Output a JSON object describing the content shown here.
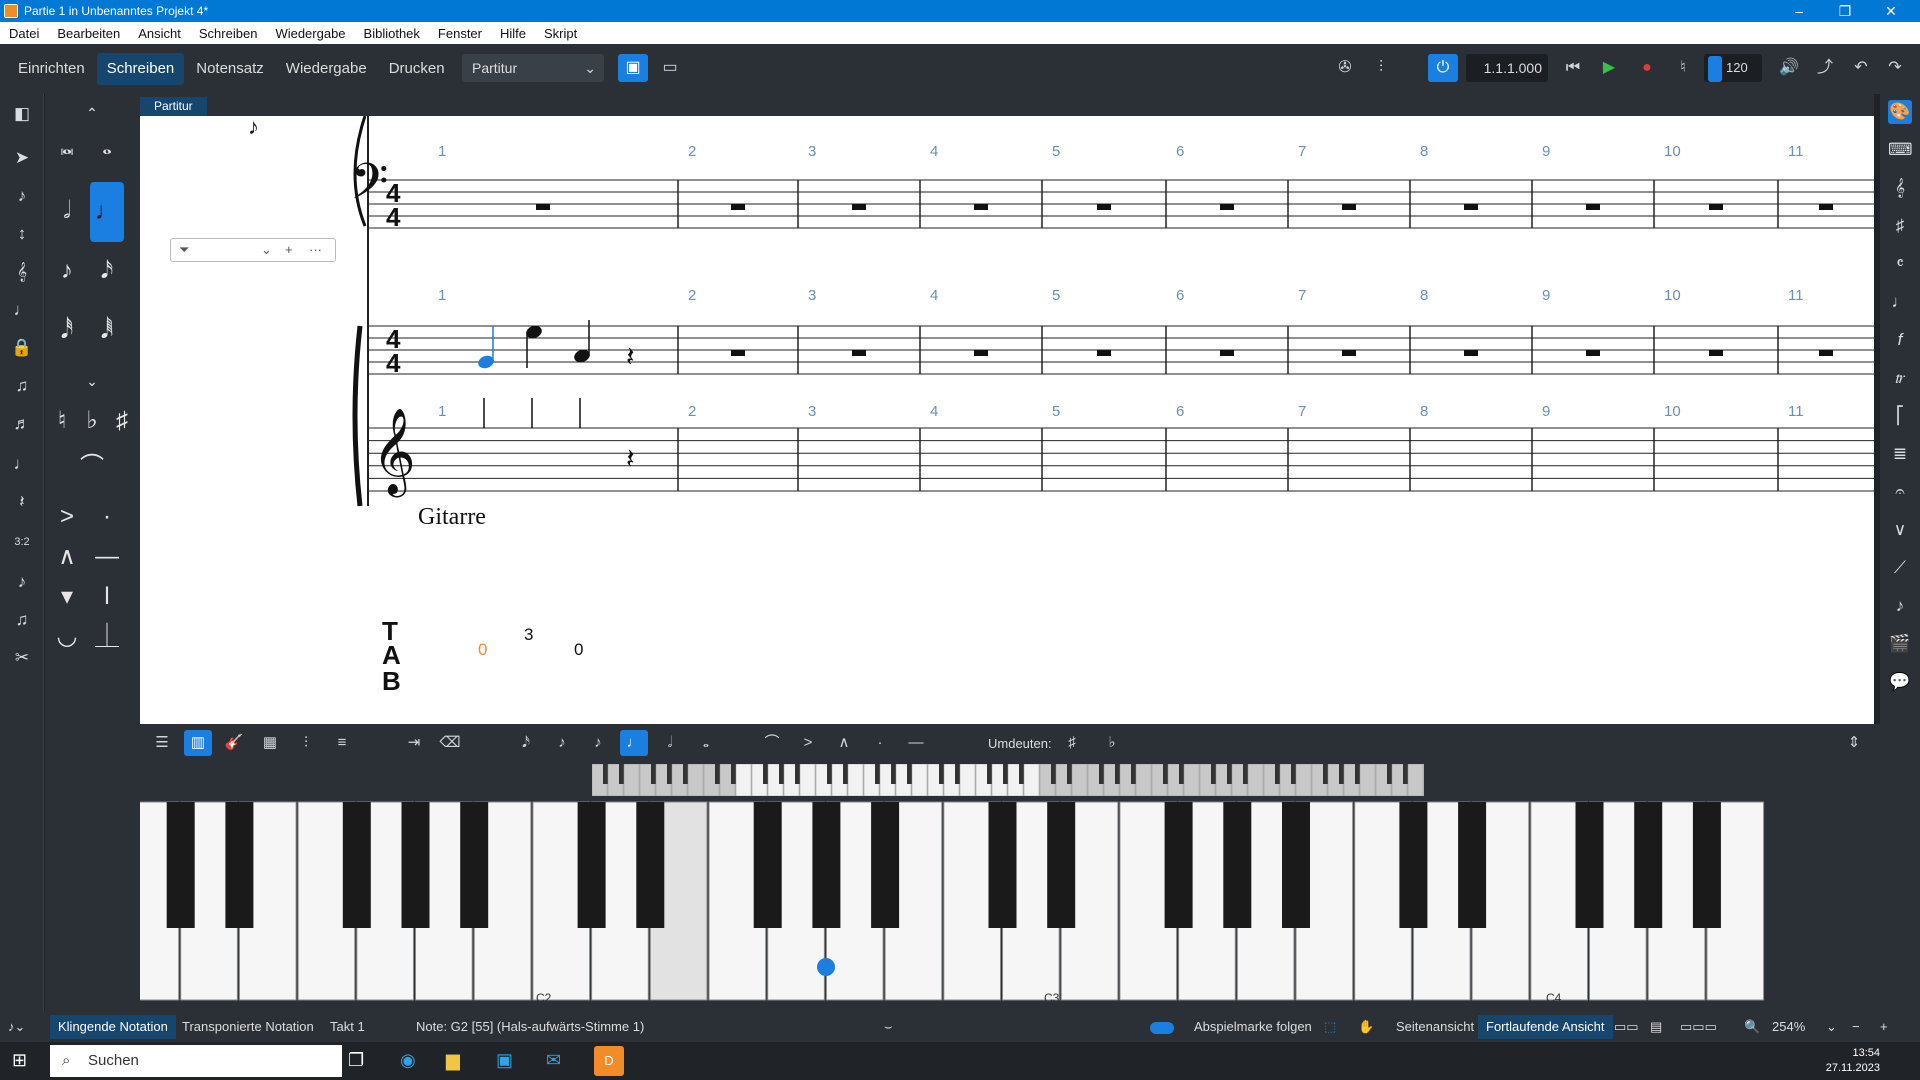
{
  "window": {
    "title": "Partie 1 in Unbenanntes Projekt 4*"
  },
  "menu": [
    "Datei",
    "Bearbeiten",
    "Ansicht",
    "Schreiben",
    "Wiedergabe",
    "Bibliothek",
    "Fenster",
    "Hilfe",
    "Skript"
  ],
  "modes": [
    "Einrichten",
    "Schreiben",
    "Notensatz",
    "Wiedergabe",
    "Drucken"
  ],
  "active_mode": "Schreiben",
  "layout_select": "Partitur",
  "transport": {
    "position": "1.1.1.000",
    "tempo": "120"
  },
  "score_tab": "Partitur",
  "score": {
    "instrument": "Gitarre",
    "bars_top": [
      "1",
      "2",
      "3",
      "4",
      "5",
      "6",
      "7",
      "8",
      "9",
      "10",
      "11"
    ],
    "time_sig": "4/4",
    "tab_letters": [
      "T",
      "A",
      "B"
    ],
    "tab_numbers": [
      "0",
      "3",
      "0"
    ]
  },
  "lower_zone": {
    "label": "Umdeuten:"
  },
  "keyboard": {
    "labels": [
      "C2",
      "C3",
      "C4"
    ]
  },
  "status": {
    "left_sel": "Klingende Notation",
    "transposed": "Transponierte Notation",
    "bar": "Takt 1",
    "note": "Note: G2 [55] (Hals-aufwärts-Stimme 1)",
    "follow": "Abspielmarke folgen",
    "page_view": "Seitenansicht",
    "galley_view": "Fortlaufende Ansicht",
    "zoom": "254%"
  },
  "taskbar": {
    "search": "Suchen",
    "time": "13:54",
    "date": "27.11.2023"
  },
  "colors": {
    "accent": "#1a7fe0",
    "selected_note": "#1a7fe0",
    "tab_highlight": "#f28c28"
  }
}
